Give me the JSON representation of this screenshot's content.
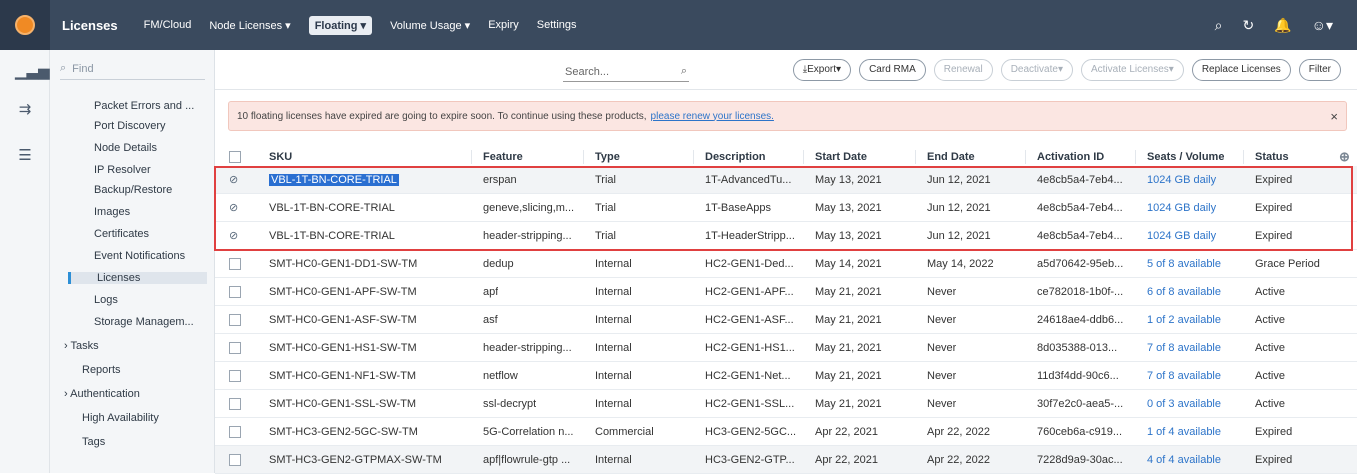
{
  "topbar": {
    "brand": "Licenses",
    "nav": [
      {
        "label": "FM/Cloud",
        "caret": false,
        "active": false
      },
      {
        "label": "Node Licenses",
        "caret": true,
        "active": false
      },
      {
        "label": "Floating",
        "caret": true,
        "active": true
      },
      {
        "label": "Volume Usage",
        "caret": true,
        "active": false
      },
      {
        "label": "Expiry",
        "caret": false,
        "active": false
      },
      {
        "label": "Settings",
        "caret": false,
        "active": false
      }
    ]
  },
  "sidebar": {
    "find_placeholder": "Find",
    "items": [
      {
        "label": "Packet Errors and ...",
        "level": "sub"
      },
      {
        "label": "Port Discovery",
        "level": "sub"
      },
      {
        "label": "Node Details",
        "level": "sub"
      },
      {
        "label": "IP Resolver",
        "level": "sub"
      },
      {
        "label": "Backup/Restore",
        "level": "sub"
      },
      {
        "label": "Images",
        "level": "sub"
      },
      {
        "label": "Certificates",
        "level": "sub"
      },
      {
        "label": "Event Notifications",
        "level": "sub"
      },
      {
        "label": "Licenses",
        "level": "sub",
        "active": true
      },
      {
        "label": "Logs",
        "level": "sub"
      },
      {
        "label": "Storage Managem...",
        "level": "sub"
      },
      {
        "label": "Tasks",
        "level": "top",
        "expander": true
      },
      {
        "label": "Reports",
        "level": "top"
      },
      {
        "label": "Authentication",
        "level": "top",
        "expander": true
      },
      {
        "label": "High Availability",
        "level": "top"
      },
      {
        "label": "Tags",
        "level": "top"
      }
    ]
  },
  "toolbar": {
    "search_placeholder": "Search...",
    "buttons": [
      {
        "label": "Export",
        "disabled": false,
        "caret": true,
        "icon": true
      },
      {
        "label": "Card RMA",
        "disabled": false
      },
      {
        "label": "Renewal",
        "disabled": true
      },
      {
        "label": "Deactivate",
        "disabled": true,
        "caret": true
      },
      {
        "label": "Activate Licenses",
        "disabled": true,
        "caret": true
      },
      {
        "label": "Replace Licenses",
        "disabled": false
      },
      {
        "label": "Filter",
        "disabled": false
      }
    ]
  },
  "alert": {
    "text": "10 floating licenses have expired are going to expire soon. To continue using these products,",
    "link": "please renew your licenses.",
    "close": "×"
  },
  "table": {
    "columns": [
      "SKU",
      "Feature",
      "Type",
      "Description",
      "Start Date",
      "End Date",
      "Activation ID",
      "Seats / Volume",
      "Status"
    ],
    "rows": [
      {
        "blocked": true,
        "sku": "VBL-1T-BN-CORE-TRIAL",
        "feature": "erspan",
        "type": "Trial",
        "description": "1T-AdvancedTu...",
        "start": "May 13, 2021",
        "end": "Jun 12, 2021",
        "activation": "4e8cb5a4-7eb4...",
        "seats": "1024 GB daily",
        "status": "Expired",
        "selected": true,
        "sku_selected": true
      },
      {
        "blocked": true,
        "sku": "VBL-1T-BN-CORE-TRIAL",
        "feature": "geneve,slicing,m...",
        "type": "Trial",
        "description": "1T-BaseApps",
        "start": "May 13, 2021",
        "end": "Jun 12, 2021",
        "activation": "4e8cb5a4-7eb4...",
        "seats": "1024 GB daily",
        "status": "Expired"
      },
      {
        "blocked": true,
        "sku": "VBL-1T-BN-CORE-TRIAL",
        "feature": "header-stripping...",
        "type": "Trial",
        "description": "1T-HeaderStripp...",
        "start": "May 13, 2021",
        "end": "Jun 12, 2021",
        "activation": "4e8cb5a4-7eb4...",
        "seats": "1024 GB daily",
        "status": "Expired"
      },
      {
        "blocked": false,
        "sku": "SMT-HC0-GEN1-DD1-SW-TM",
        "feature": "dedup",
        "type": "Internal",
        "description": "HC2-GEN1-Ded...",
        "start": "May 14, 2021",
        "end": "May 14, 2022",
        "activation": "a5d70642-95eb...",
        "seats": "5 of 8 available",
        "status": "Grace Period"
      },
      {
        "blocked": false,
        "sku": "SMT-HC0-GEN1-APF-SW-TM",
        "feature": "apf",
        "type": "Internal",
        "description": "HC2-GEN1-APF...",
        "start": "May 21, 2021",
        "end": "Never",
        "activation": "ce782018-1b0f-...",
        "seats": "6 of 8 available",
        "status": "Active"
      },
      {
        "blocked": false,
        "sku": "SMT-HC0-GEN1-ASF-SW-TM",
        "feature": "asf",
        "type": "Internal",
        "description": "HC2-GEN1-ASF...",
        "start": "May 21, 2021",
        "end": "Never",
        "activation": "24618ae4-ddb6...",
        "seats": "1 of 2 available",
        "status": "Active"
      },
      {
        "blocked": false,
        "sku": "SMT-HC0-GEN1-HS1-SW-TM",
        "feature": "header-stripping...",
        "type": "Internal",
        "description": "HC2-GEN1-HS1...",
        "start": "May 21, 2021",
        "end": "Never",
        "activation": "8d035388-013...",
        "seats": "7 of 8 available",
        "status": "Active"
      },
      {
        "blocked": false,
        "sku": "SMT-HC0-GEN1-NF1-SW-TM",
        "feature": "netflow",
        "type": "Internal",
        "description": "HC2-GEN1-Net...",
        "start": "May 21, 2021",
        "end": "Never",
        "activation": "11d3f4dd-90c6...",
        "seats": "7 of 8 available",
        "status": "Active"
      },
      {
        "blocked": false,
        "sku": "SMT-HC0-GEN1-SSL-SW-TM",
        "feature": "ssl-decrypt",
        "type": "Internal",
        "description": "HC2-GEN1-SSL...",
        "start": "May 21, 2021",
        "end": "Never",
        "activation": "30f7e2c0-aea5-...",
        "seats": "0 of 3 available",
        "status": "Active"
      },
      {
        "blocked": false,
        "sku": "SMT-HC3-GEN2-5GC-SW-TM",
        "feature": "5G-Correlation n...",
        "type": "Commercial",
        "description": "HC3-GEN2-5GC...",
        "start": "Apr 22, 2021",
        "end": "Apr 22, 2022",
        "activation": "760ceb6a-c919...",
        "seats": "1 of 4 available",
        "status": "Expired"
      },
      {
        "blocked": false,
        "sku": "SMT-HC3-GEN2-GTPMAX-SW-TM",
        "feature": "apf|flowrule-gtp ...",
        "type": "Internal",
        "description": "HC3-GEN2-GTP...",
        "start": "Apr 22, 2021",
        "end": "Apr 22, 2022",
        "activation": "7228d9a9-30ac...",
        "seats": "4 of 4 available",
        "status": "Expired",
        "selected": true
      }
    ]
  }
}
